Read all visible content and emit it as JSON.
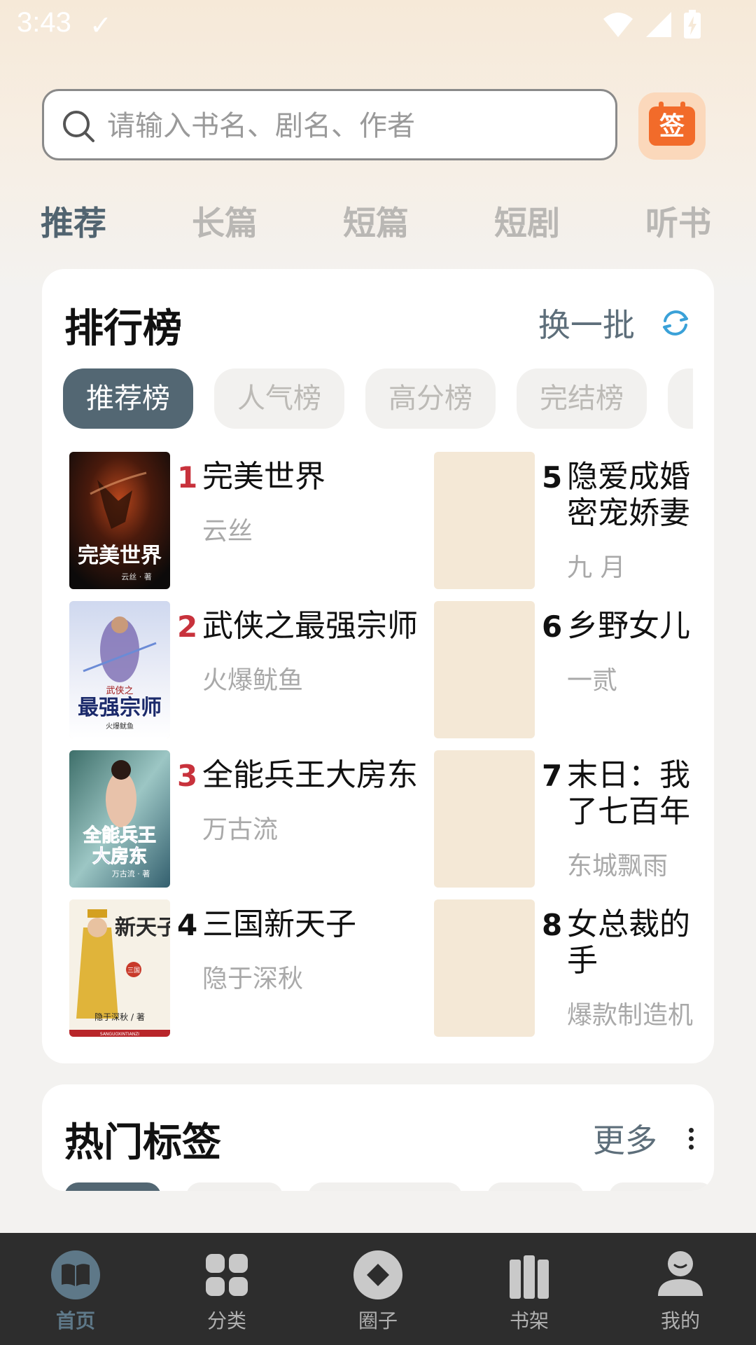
{
  "status_bar": {
    "time": "3:43",
    "icons": [
      "check-icon",
      "wifi-icon",
      "signal-icon",
      "battery-charging-icon"
    ]
  },
  "search": {
    "placeholder": "请输入书名、剧名、作者",
    "value": ""
  },
  "checkin": {
    "label": "签",
    "color": "#f26b2a"
  },
  "channel_tabs": [
    {
      "label": "推荐",
      "active": true
    },
    {
      "label": "长篇",
      "active": false
    },
    {
      "label": "短篇",
      "active": false
    },
    {
      "label": "短剧",
      "active": false
    },
    {
      "label": "听书",
      "active": false
    }
  ],
  "ranking": {
    "title": "排行榜",
    "refresh_label": "换一批",
    "tabs": [
      {
        "label": "推荐榜",
        "active": true
      },
      {
        "label": "人气榜",
        "active": false
      },
      {
        "label": "高分榜",
        "active": false
      },
      {
        "label": "完结榜",
        "active": false
      }
    ],
    "books": [
      {
        "rank": "1",
        "title": "完美世界",
        "author": "云丝"
      },
      {
        "rank": "2",
        "title": "武侠之最强宗师",
        "author": "火爆鱿鱼"
      },
      {
        "rank": "3",
        "title": "全能兵王大房东",
        "author": "万古流"
      },
      {
        "rank": "4",
        "title": "三国新天子",
        "author": "隐于深秋"
      },
      {
        "rank": "5",
        "title": "隐爱成婚 密宠娇妻",
        "author": "九 月"
      },
      {
        "rank": "6",
        "title": "乡野女儿",
        "author": "一贰"
      },
      {
        "rank": "7",
        "title": "末日：我 了七百年",
        "author": "东城飘雨"
      },
      {
        "rank": "8",
        "title": "女总裁的 手",
        "author": "爆款制造机"
      }
    ],
    "cover_texts": {
      "c1_title": "完美世界",
      "c1_author": "云丝 · 著",
      "c2_top": "武侠之",
      "c2_title": "最强宗师",
      "c2_author": "火爆鱿鱼",
      "c3_title_1": "全能兵王",
      "c3_title_2": "大房东",
      "c3_author": "万古流 · 著",
      "c4_title": "新天子",
      "c4_seal": "三国",
      "c4_author": "隐于深秋 / 著",
      "c4_footer": "SANGUOXINTIANZI"
    },
    "rank_colors": {
      "top3": "#c8323c",
      "rest": "#111111"
    }
  },
  "hot_tags": {
    "title": "热门标签",
    "more_label": "更多"
  },
  "bottom_nav": [
    {
      "label": "首页",
      "icon": "book-open-icon",
      "active": true
    },
    {
      "label": "分类",
      "icon": "grid-icon",
      "active": false
    },
    {
      "label": "圈子",
      "icon": "circle-icon",
      "active": false
    },
    {
      "label": "书架",
      "icon": "bookshelf-icon",
      "active": false
    },
    {
      "label": "我的",
      "icon": "person-icon",
      "active": false
    }
  ],
  "colors": {
    "accent": "#536773",
    "nav_background": "#2d2d2d",
    "placeholder_cover": "#f4e8d6"
  }
}
